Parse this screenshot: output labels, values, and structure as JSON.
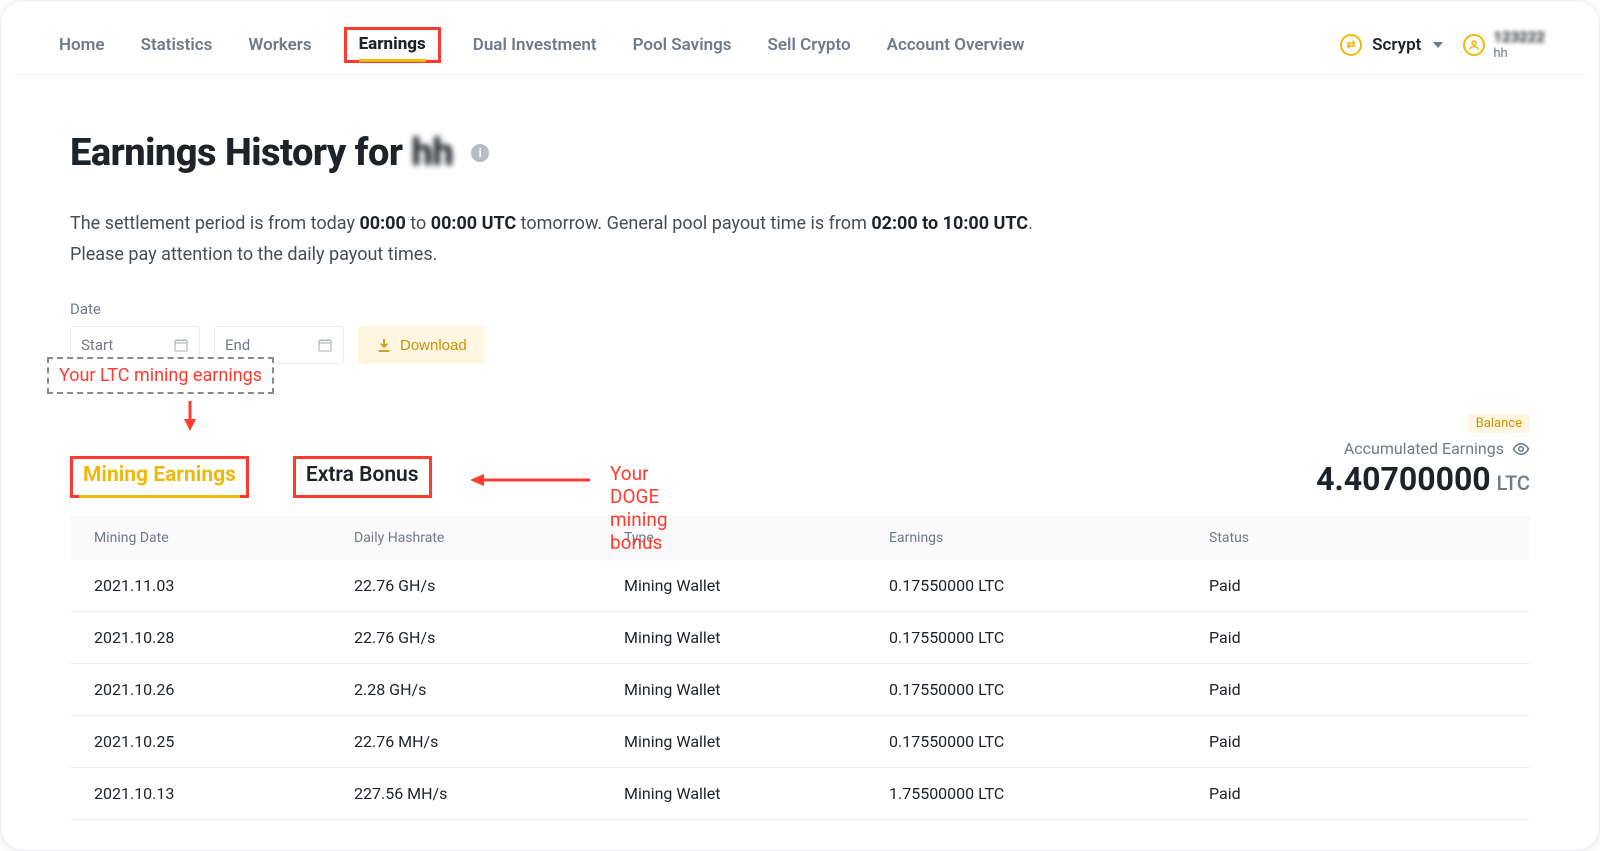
{
  "nav": {
    "items": [
      "Home",
      "Statistics",
      "Workers",
      "Earnings",
      "Dual Investment",
      "Pool Savings",
      "Sell Crypto",
      "Account Overview"
    ],
    "active_index": 3,
    "algo_label": "Scrypt",
    "account_blur": "123222",
    "account_sub": "hh"
  },
  "title": {
    "prefix": "Earnings History for",
    "blurred_name": "hh"
  },
  "description": {
    "text_a": "The settlement period is from today ",
    "time_a": "00:00",
    "text_b": " to ",
    "time_b": "00:00 UTC",
    "text_c": " tomorrow. General pool payout time is from ",
    "time_c": "02:00 to 10:00 UTC",
    "text_d": ".",
    "line2": "Please pay attention to the daily payout times."
  },
  "date": {
    "label": "Date",
    "start_placeholder": "Start",
    "end_placeholder": "End",
    "download_label": "Download"
  },
  "annotations": {
    "ltc_callout": "Your LTC mining earnings",
    "doge_callout": "Your DOGE mining bonus"
  },
  "subtabs": {
    "mining_label": "Mining Earnings",
    "bonus_label": "Extra Bonus"
  },
  "balance": {
    "chip": "Balance",
    "label": "Accumulated Earnings",
    "value": "4.40700000",
    "unit": "LTC"
  },
  "columns": [
    "Mining Date",
    "Daily Hashrate",
    "Type",
    "Earnings",
    "Status"
  ],
  "rows": [
    {
      "date": "2021.11.03",
      "hash": "22.76 GH/s",
      "type": "Mining Wallet",
      "earn": "0.17550000 LTC",
      "status": "Paid"
    },
    {
      "date": "2021.10.28",
      "hash": "22.76 GH/s",
      "type": "Mining Wallet",
      "earn": "0.17550000 LTC",
      "status": "Paid"
    },
    {
      "date": "2021.10.26",
      "hash": "2.28 GH/s",
      "type": "Mining Wallet",
      "earn": "0.17550000 LTC",
      "status": "Paid"
    },
    {
      "date": "2021.10.25",
      "hash": "22.76 MH/s",
      "type": "Mining Wallet",
      "earn": "0.17550000 LTC",
      "status": "Paid"
    },
    {
      "date": "2021.10.13",
      "hash": "227.56 MH/s",
      "type": "Mining Wallet",
      "earn": "1.75500000 LTC",
      "status": "Paid"
    }
  ]
}
